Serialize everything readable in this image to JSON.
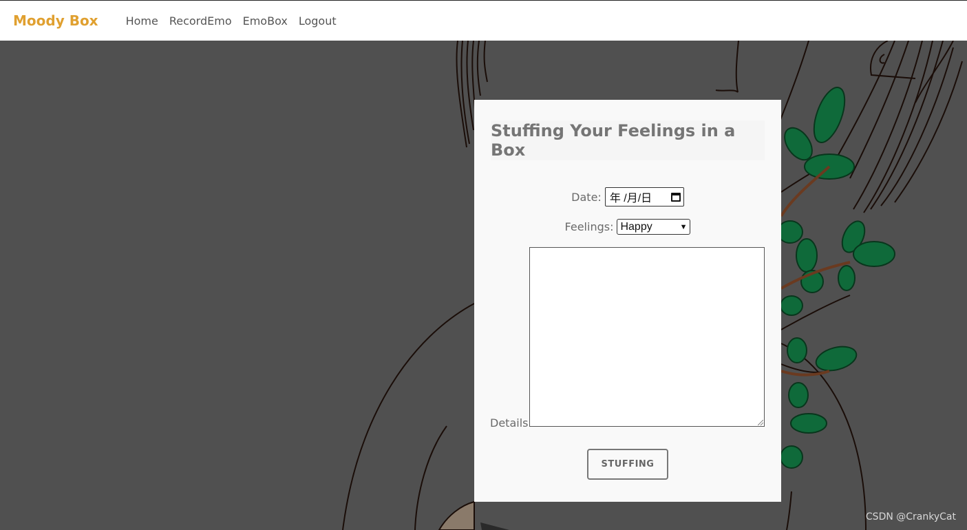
{
  "navbar": {
    "brand": "Moody Box",
    "links": [
      "Home",
      "RecordEmo",
      "EmoBox",
      "Logout"
    ]
  },
  "form": {
    "title": "Stuffing Your Feelings in a Box",
    "date_label": "Date:",
    "date_value": "年 /月/日",
    "feelings_label": "Feelings:",
    "feelings_value": "Happy",
    "details_label": "Details:",
    "details_value": "",
    "submit_label": "STUFFING"
  },
  "watermark": "CSDN @CrankyCat",
  "colors": {
    "brand": "#e0a030",
    "background": "#505050",
    "card": "#f9f9f9",
    "leaf": "#0f6a3a"
  }
}
